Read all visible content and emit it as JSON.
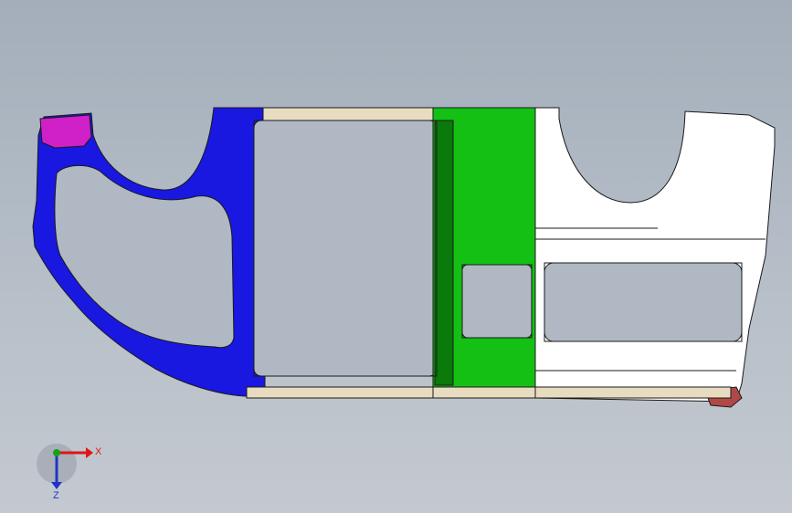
{
  "view": {
    "triad": {
      "x_label": "X",
      "z_label": "Z",
      "x_color": "#e0161a",
      "y_color": "#1aa01a",
      "z_color": "#2033c8"
    }
  },
  "model": {
    "colors": {
      "front_section": "#1818e0",
      "front_section_dark": "#0c0c90",
      "hinge_part": "#d020c8",
      "middle_section": "#14c014",
      "middle_section_dark": "#0a7a0a",
      "rear_section": "#ffffff",
      "rear_bracket": "#b04848",
      "sill_strip": "#e8dcc0",
      "edge": "#1a1a1a"
    }
  }
}
